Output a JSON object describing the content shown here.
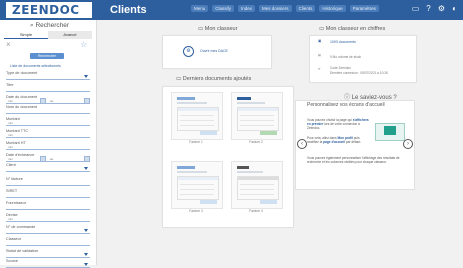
{
  "header": {
    "logo_text": "ZEENDOC",
    "app_title": "Clients",
    "nav_items": [
      "Menu",
      "Classify",
      "Index",
      "Mes dossiers",
      "Clients",
      "Historique",
      "Paramètres"
    ],
    "icons": [
      "monitor-icon",
      "help-icon",
      "gear-icon",
      "user-icon"
    ],
    "accent_color": "#2d5f9e"
  },
  "sidebar": {
    "title": "Rechercher",
    "tabs": [
      "Simple",
      "Avancé"
    ],
    "search_button": "Rechercher",
    "saved_link": "Liste de documents sélectionnés",
    "fields": {
      "type": "Type de document",
      "titre": "Titre",
      "date_doc": "Date du document",
      "au": "au",
      "nom_doc": "Nom du document",
      "montant": "Montant",
      "montant_ttc": "Montant TTC",
      "montant_ht": "Montant HT",
      "date_echeance": "Date d'échéance",
      "client": "Client",
      "ref": "N° facture",
      "siret": "SIRET",
      "fournisseur": "Fournisseur",
      "devise": "Devise",
      "ordre": "N° de commande",
      "classeur": "Classeur",
      "statut": "Statut de validation",
      "source": "Source"
    },
    "min_placeholder": "min",
    "max_placeholder": "max"
  },
  "panels": {
    "mon_classeur": {
      "title": "Mon classeur",
      "link": "Ouvrir mes DACE"
    },
    "chiffres": {
      "title": "Mon classeur en chiffres",
      "line1": "1093 documents",
      "line2": "9 Mo volume de stock",
      "line3": "Code Zeendoc",
      "line4": "Dernière connexion : 05/07/2021 à 10:26"
    },
    "derniers": {
      "title": "Derniers documents ajoutés",
      "docs": [
        "Facture 1",
        "Facture 2",
        "Facture 3",
        "Facture 4"
      ]
    },
    "le_saviez_vous": {
      "head": "Le saviez-vous ?",
      "title": "Personnalisez vos écrans d'accueil",
      "p1_a": "Vous pouvez choisir la page qui ",
      "p1_b": "s'affichera en premier",
      "p1_c": " lors de votre connexion à Zeendoc.",
      "p2_a": "Pour cela, allez dans ",
      "p2_b": "Mon profil",
      "p2_c": " puis modifiez la ",
      "p2_d": "page d'accueil",
      "p2_e": " par défaut.",
      "p3": "Vous pouvez également personnaliser l'affichage des résultats de recherche et les colonnes visibles pour chaque classeur."
    }
  }
}
